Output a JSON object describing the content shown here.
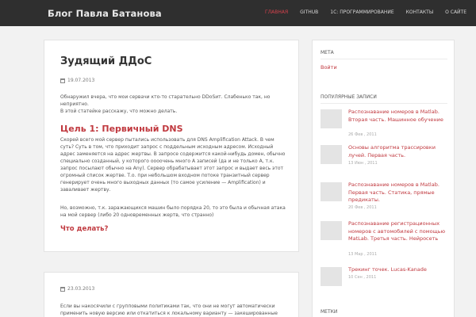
{
  "header": {
    "site_title": "Блог Павла Батанова",
    "nav": [
      {
        "label": "ГЛАВНАЯ",
        "active": true
      },
      {
        "label": "GITHUB",
        "active": false
      },
      {
        "label": "1С: ПРОГРАММИРОВАНИЕ",
        "active": false
      },
      {
        "label": "КОНТАКТЫ",
        "active": false
      },
      {
        "label": "О САЙТЕ",
        "active": false
      }
    ]
  },
  "posts": [
    {
      "title": "Зудящий ДДоС",
      "date": "19.07.2013",
      "intro": "Обнаружил вчера, что мои сервачи кто-то старательно DDoSит. Слабенько так, но неприятно.",
      "intro2": "В этой статейке расскажу, что можно делать.",
      "heading1": "Цель 1: Первичный DNS",
      "body1": "Скорей всего мой сервер пытались использовать для DNS Amplification Attack. В чем суть? Суть в том, что приходит запрос с поддельным исходным адресом. Исходный адрес заменяется на адрес жертвы. В запросе содержится какой-нибудь домен, обычно специально созданный, у которого оооочень много A записей (да и не только A, т.к. запрос посылают обычно на Any). Сервер обрабатывает этот запрос и выдает весь этот огромный список жертве. Т.о. при небольшом входном потоке транзитный сервер генерирует очень много выходных данных (то самое усиление — Amplification) и заваливает жертву.",
      "body2": "Но, возможно, т.к. заражающихся машин было порядка 20, то это была и обычная атака на мой сервер (либо 20 одновременных жертв, что странно)",
      "heading2": "Что делать?"
    },
    {
      "date": "23.03.2013",
      "body1": "Если вы накосячили с групповыми политиками так, что они не могут автоматически применить новую версию или откатиться к локальному варианту — закешированные"
    }
  ],
  "sidebar": {
    "meta_title": "МЕТА",
    "meta_link": "Войти",
    "popular_title": "ПОПУЛЯРНЫЕ ЗАПИСИ",
    "popular": [
      {
        "title": "Распознавание номеров в Matlab. Вторая часть. Машинное обучение",
        "date": "26 Фев , 2011"
      },
      {
        "title": "Основы алгоритма трассировки лучей. Первая часть.",
        "date": "13 Июн , 2011"
      },
      {
        "title": "Распознавание номеров в Matlab. Первая часть. Статика, прямые предикаты.",
        "date": "20 Фев , 2011"
      },
      {
        "title": "Распознавание регистрационных номеров с автомобилей с помощью MatLab. Третья часть. Нейросеть",
        "date": "13 Мар , 2011"
      },
      {
        "title": "Трекинг точек. Lucas-Kanade",
        "date": "10 Сен , 2011"
      }
    ],
    "tags_title": "МЕТКИ"
  }
}
